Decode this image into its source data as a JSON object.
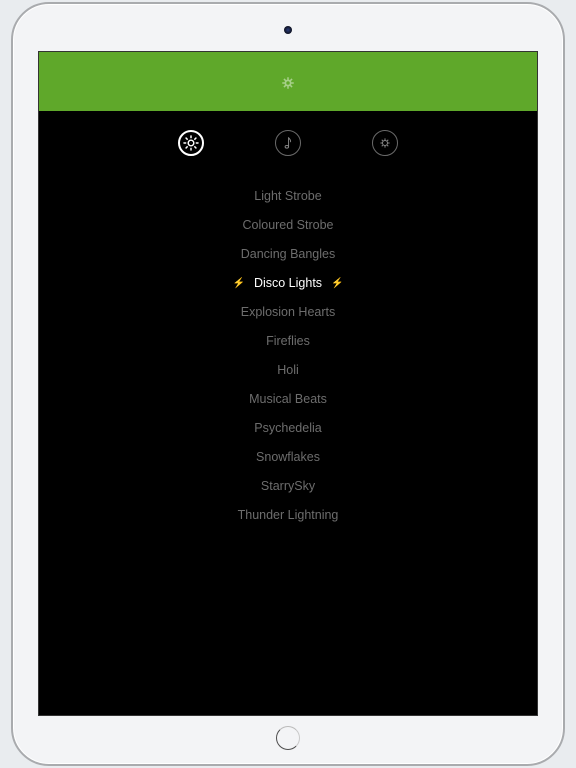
{
  "device": {
    "type": "tablet",
    "camera_icon": "camera-dot",
    "home_button_icon": "home-button-circle"
  },
  "header": {
    "background_color": "#5fa82a",
    "icon": "gear-icon"
  },
  "tabs": [
    {
      "name": "light",
      "icon": "sun-icon",
      "active": true
    },
    {
      "name": "music",
      "icon": "music-note-icon",
      "active": false
    },
    {
      "name": "settings",
      "icon": "gear-icon",
      "active": false
    }
  ],
  "effects": {
    "selected_index": 3,
    "selected_marker": "⚡",
    "items": [
      {
        "label": "Light Strobe"
      },
      {
        "label": "Coloured Strobe"
      },
      {
        "label": "Dancing Bangles"
      },
      {
        "label": "Disco Lights"
      },
      {
        "label": "Explosion Hearts"
      },
      {
        "label": "Fireflies"
      },
      {
        "label": "Holi"
      },
      {
        "label": "Musical Beats"
      },
      {
        "label": "Psychedelia"
      },
      {
        "label": "Snowflakes"
      },
      {
        "label": "StarrySky"
      },
      {
        "label": "Thunder Lightning"
      }
    ]
  },
  "colors": {
    "item_text": "#6d6d6d",
    "selected_text": "#ffffff",
    "screen_background": "#000000"
  }
}
